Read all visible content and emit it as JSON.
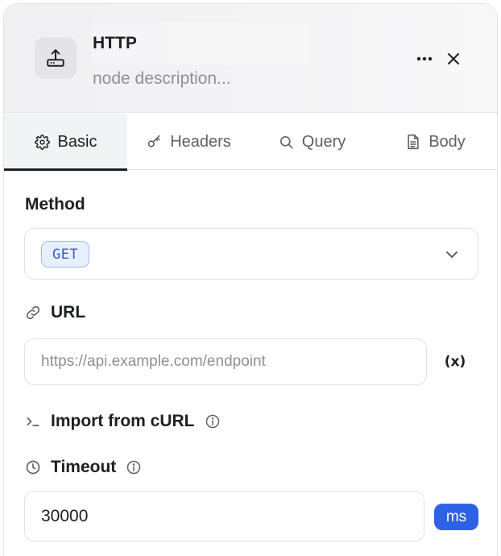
{
  "node": {
    "title": "HTTP",
    "description_placeholder": "node description...",
    "icon": "upload-tray-icon"
  },
  "header_actions": {
    "more": "more-icon",
    "close": "close-icon"
  },
  "tabs": [
    {
      "label": "Basic",
      "icon": "gear-icon",
      "active": true
    },
    {
      "label": "Headers",
      "icon": "key-icon",
      "active": false
    },
    {
      "label": "Query",
      "icon": "search-icon",
      "active": false
    },
    {
      "label": "Body",
      "icon": "document-icon",
      "active": false
    }
  ],
  "method": {
    "label": "Method",
    "value": "GET"
  },
  "url": {
    "label": "URL",
    "value": "",
    "placeholder": "https://api.example.com/endpoint",
    "variable_button": "(x)"
  },
  "import_curl": {
    "label": "Import from cURL"
  },
  "timeout": {
    "label": "Timeout",
    "value": "30000",
    "unit": "ms"
  },
  "colors": {
    "accent": "#2e62e6",
    "method_badge_bg": "#e8efff",
    "method_badge_text": "#2f5fd0"
  }
}
